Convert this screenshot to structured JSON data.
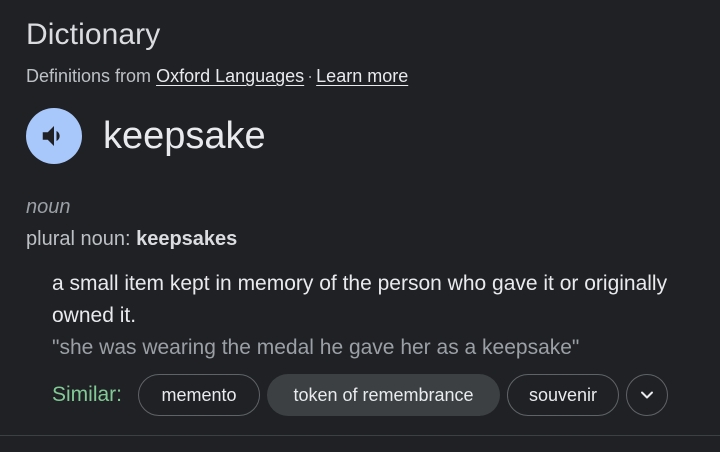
{
  "header": {
    "title": "Dictionary",
    "source_prefix": "Definitions from",
    "source_link": "Oxford Languages",
    "separator": "·",
    "learn_more": "Learn more"
  },
  "entry": {
    "speaker_icon": "volume-icon",
    "headword": "keepsake",
    "part_of_speech": "noun",
    "plural_label": "plural noun:",
    "plural_form": "keepsakes",
    "definition": "a small item kept in memory of the person who gave it or originally owned it.",
    "example": "\"she was wearing the medal he gave her as a keepsake\""
  },
  "similar": {
    "label": "Similar:",
    "chips": [
      "memento",
      "token of remembrance",
      "souvenir"
    ],
    "expand_icon": "chevron-down-icon"
  },
  "colors": {
    "background": "#202124",
    "speaker_button": "#a8c7fa",
    "similar_label": "#81c995",
    "chip_filled": "#3c4043",
    "chip_border": "#5f6368"
  }
}
